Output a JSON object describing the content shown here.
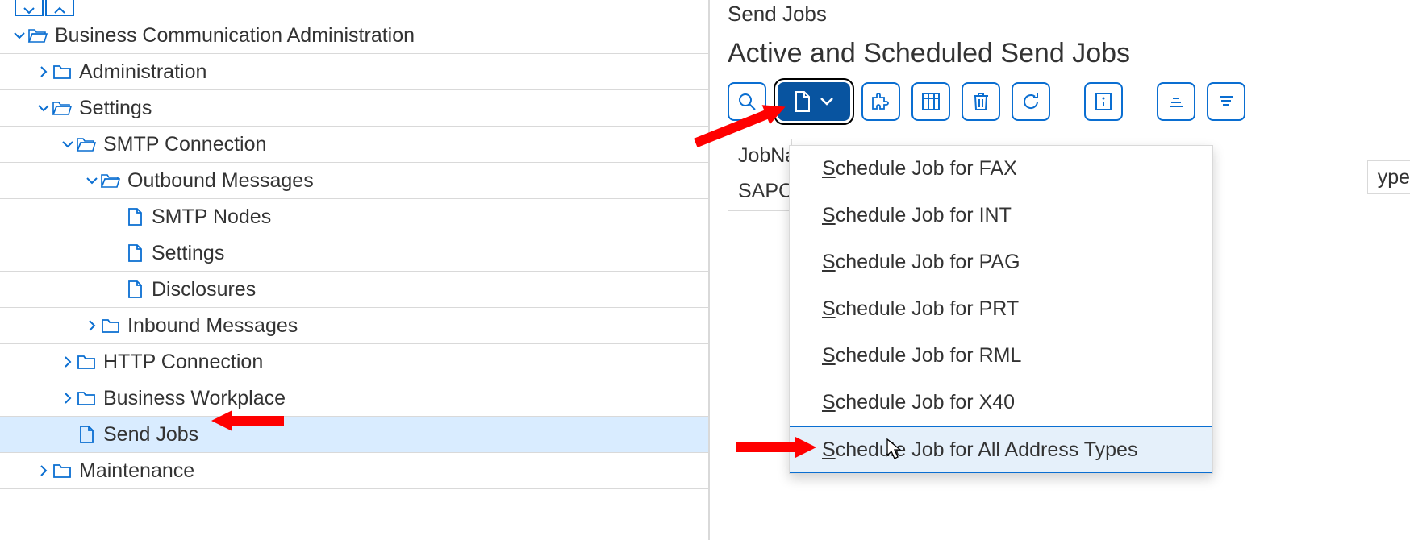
{
  "left": {
    "tree": [
      {
        "level": 0,
        "expand": "down",
        "iconType": "folder-open",
        "label": "Business Communication Administration",
        "selected": false
      },
      {
        "level": 1,
        "expand": "right",
        "iconType": "folder",
        "label": "Administration",
        "selected": false
      },
      {
        "level": 1,
        "expand": "down",
        "iconType": "folder-open",
        "label": "Settings",
        "selected": false
      },
      {
        "level": 2,
        "expand": "down",
        "iconType": "folder-open",
        "label": "SMTP Connection",
        "selected": false
      },
      {
        "level": 3,
        "expand": "down",
        "iconType": "folder-open",
        "label": "Outbound Messages",
        "selected": false
      },
      {
        "level": 4,
        "expand": "none",
        "iconType": "doc",
        "label": "SMTP Nodes",
        "selected": false
      },
      {
        "level": 4,
        "expand": "none",
        "iconType": "doc",
        "label": "Settings",
        "selected": false
      },
      {
        "level": 4,
        "expand": "none",
        "iconType": "doc",
        "label": "Disclosures",
        "selected": false
      },
      {
        "level": 3,
        "expand": "right",
        "iconType": "folder",
        "label": "Inbound Messages",
        "selected": false
      },
      {
        "level": 2,
        "expand": "right",
        "iconType": "folder",
        "label": "HTTP Connection",
        "selected": false
      },
      {
        "level": 2,
        "expand": "right",
        "iconType": "folder",
        "label": "Business Workplace",
        "selected": false
      },
      {
        "level": 2,
        "expand": "none",
        "iconType": "doc",
        "label": "Send Jobs",
        "selected": true
      },
      {
        "level": 1,
        "expand": "right",
        "iconType": "folder",
        "label": "Maintenance",
        "selected": false
      }
    ]
  },
  "right": {
    "title": "Send Jobs",
    "subtitle": "Active and Scheduled Send Jobs",
    "toolbar": {
      "buttons": [
        {
          "name": "search-icon",
          "label": "Search"
        },
        {
          "name": "create-dropdown",
          "label": "Create"
        },
        {
          "name": "puzzle-icon",
          "label": "Variant"
        },
        {
          "name": "columns-icon",
          "label": "Layout"
        },
        {
          "name": "trash-icon",
          "label": "Delete"
        },
        {
          "name": "refresh-icon",
          "label": "Refresh"
        },
        {
          "name": "info-icon",
          "label": "Details"
        },
        {
          "name": "sort-asc-icon",
          "label": "Sort Ascending"
        },
        {
          "name": "sort-desc-icon",
          "label": "Sort Descending"
        }
      ]
    },
    "columns": {
      "jobname": "JobName",
      "type": "ype"
    },
    "rows": [
      {
        "jobname": "SAPC"
      }
    ],
    "menu": [
      {
        "mn": "S",
        "rest": "chedule Job for FAX"
      },
      {
        "mn": "S",
        "rest": "chedule Job for INT"
      },
      {
        "mn": "S",
        "rest": "chedule Job for PAG"
      },
      {
        "mn": "S",
        "rest": "chedule Job for PRT"
      },
      {
        "mn": "S",
        "rest": "chedule Job for RML"
      },
      {
        "mn": "S",
        "rest": "chedule Job for X40"
      },
      {
        "mn": "S",
        "rest": "chedule Job for All Address Types"
      }
    ],
    "menu_hover_index": 6
  }
}
